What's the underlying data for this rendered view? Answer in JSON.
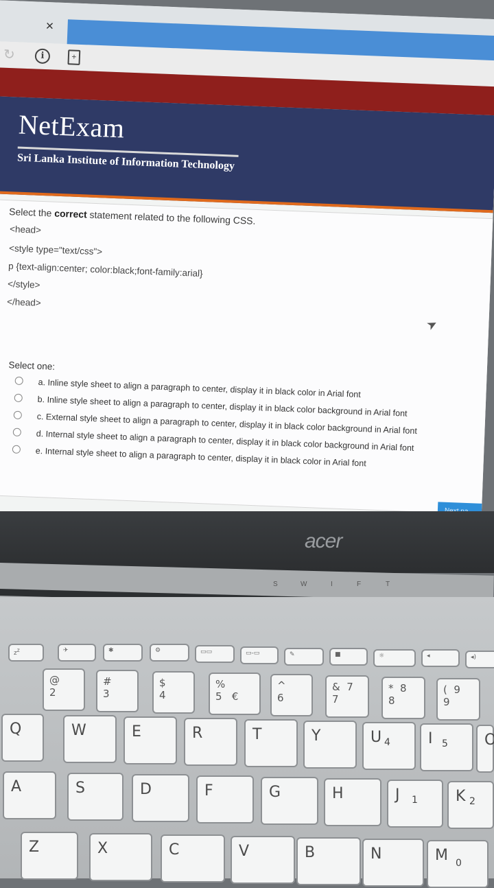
{
  "browser": {
    "close_glyph": "×",
    "info_glyph": "i",
    "page_glyph": "+"
  },
  "site": {
    "logo": "NetExam",
    "subtitle": "Sri Lanka Institute of Information Technology"
  },
  "question": {
    "prefix": "Select the ",
    "bold": "correct",
    "suffix": " statement related to the following CSS.",
    "code_lines": [
      "<head>",
      "<style type=\"text/css\">",
      "p {text-align:center; color:black;font-family:arial}",
      "</style>",
      "</head>"
    ],
    "select_label": "Select one:",
    "options": [
      "a. Inline style sheet to align a paragraph to center, display it in black color in Arial font",
      "b. Inline style sheet to align a paragraph to center, display it in black color background in Arial font",
      "c. External style sheet to align a paragraph to center, display it in black color background in Arial font",
      "d. Internal style sheet to align a paragraph to center, display it in black color background in Arial font",
      "e. Internal style sheet to align a paragraph to center, display it in black color in Arial font"
    ],
    "next_button": "Next pa"
  },
  "laptop": {
    "brand": "acer",
    "status_letters": [
      "S",
      "W",
      "I",
      "F",
      "T"
    ]
  },
  "keyboard": {
    "number_row": [
      {
        "top": "@",
        "bottom": "2"
      },
      {
        "top": "#",
        "bottom": "3"
      },
      {
        "top": "$",
        "bottom": "4"
      },
      {
        "top": "%",
        "bottom": "5",
        "extra": "€"
      },
      {
        "top": "^",
        "bottom": "6"
      },
      {
        "top": "&",
        "bottom": "7",
        "extra": "7"
      },
      {
        "top": "*",
        "bottom": "8",
        "extra": "8"
      },
      {
        "top": "(",
        "bottom": "9",
        "extra": "9"
      }
    ],
    "row_q": [
      "Q",
      "W",
      "E",
      "R",
      "T",
      "Y",
      "U",
      "I",
      "O"
    ],
    "row_q_sub": {
      "U": "4",
      "I": "5"
    },
    "row_a": [
      "A",
      "S",
      "D",
      "F",
      "G",
      "H",
      "J",
      "K"
    ],
    "row_a_sub": {
      "J": "1",
      "K": "2"
    },
    "row_z": [
      "Z",
      "X",
      "C",
      "V",
      "B",
      "N",
      "M"
    ],
    "row_z_sub": {
      "M": "0"
    }
  },
  "colors": {
    "header_bg": "#2f3a66",
    "accent_red": "#8f1f1c",
    "orange_rule": "#e06a1c",
    "next_button": "#2f8fd9"
  }
}
